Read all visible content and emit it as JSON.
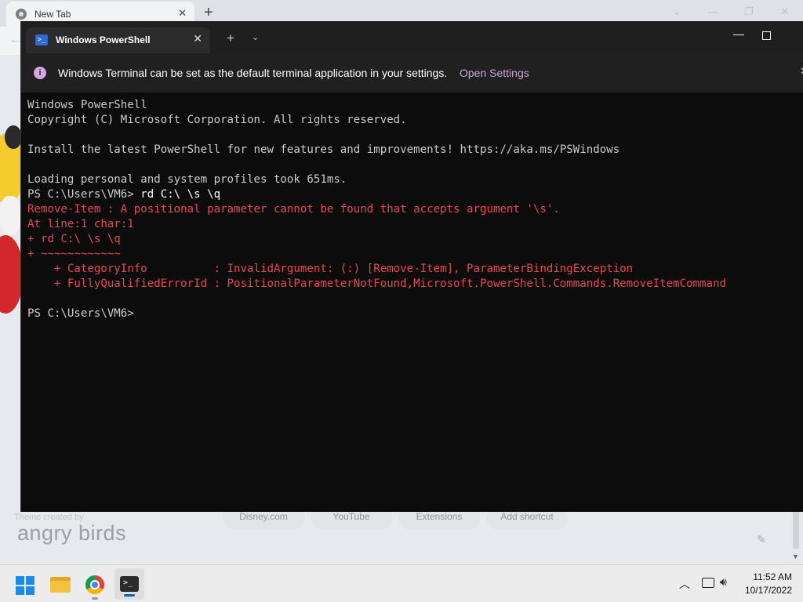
{
  "chrome": {
    "tab_title": "New Tab",
    "theme_credit": "Theme created by",
    "theme_name": "angry birds",
    "shortcuts": [
      "Disney.com",
      "YouTube",
      "Extensions",
      "Add shortcut"
    ]
  },
  "terminal": {
    "tab_title": "Windows PowerShell",
    "infobar": {
      "message": "Windows Terminal can be set as the default terminal application in your settings.",
      "link": "Open Settings"
    },
    "lines": [
      {
        "text": "Windows PowerShell",
        "kind": "normal"
      },
      {
        "text": "Copyright (C) Microsoft Corporation. All rights reserved.",
        "kind": "normal"
      },
      {
        "text": "",
        "kind": "normal"
      },
      {
        "text": "Install the latest PowerShell for new features and improvements! https://aka.ms/PSWindows",
        "kind": "normal"
      },
      {
        "text": "",
        "kind": "normal"
      },
      {
        "text": "Loading personal and system profiles took 651ms.",
        "kind": "normal"
      },
      {
        "text": "PS C:\\Users\\VM6> ",
        "kind": "prompt",
        "command": "rd C:\\ \\s \\q"
      },
      {
        "text": "Remove-Item : A positional parameter cannot be found that accepts argument '\\s'.",
        "kind": "error"
      },
      {
        "text": "At line:1 char:1",
        "kind": "error"
      },
      {
        "text": "+ rd C:\\ \\s \\q",
        "kind": "error"
      },
      {
        "text": "+ ~~~~~~~~~~~~",
        "kind": "error"
      },
      {
        "text": "    + CategoryInfo          : InvalidArgument: (:) [Remove-Item], ParameterBindingException",
        "kind": "error"
      },
      {
        "text": "    + FullyQualifiedErrorId : PositionalParameterNotFound,Microsoft.PowerShell.Commands.RemoveItemCommand",
        "kind": "error"
      },
      {
        "text": "",
        "kind": "normal"
      },
      {
        "text": "PS C:\\Users\\VM6>",
        "kind": "normal"
      }
    ]
  },
  "taskbar": {
    "time": "11:52 AM",
    "date": "10/17/2022",
    "icons": [
      "start-icon",
      "file-explorer-icon",
      "chrome-icon",
      "terminal-icon",
      "chevron-up-icon",
      "network-icon",
      "volume-icon"
    ]
  },
  "colors": {
    "terminal_bg": "#0c0c0c",
    "terminal_text": "#cccccc",
    "error_text": "#e74856",
    "accent": "#0067c0"
  }
}
